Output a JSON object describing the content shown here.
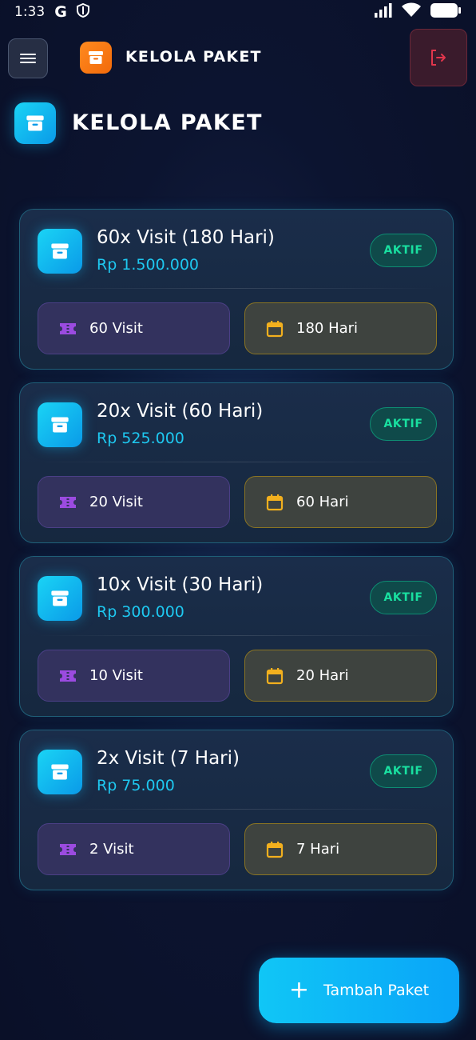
{
  "status_bar": {
    "time": "1:33"
  },
  "app_bar": {
    "title": "KELOLA PAKET"
  },
  "page": {
    "title": "KELOLA PAKET"
  },
  "packages": [
    {
      "name": "60x Visit (180 Hari)",
      "price": "Rp 1.500.000",
      "status": "AKTIF",
      "visits": "60 Visit",
      "days": "180 Hari"
    },
    {
      "name": "20x Visit (60 Hari)",
      "price": "Rp 525.000",
      "status": "AKTIF",
      "visits": "20 Visit",
      "days": "60 Hari"
    },
    {
      "name": "10x Visit (30 Hari)",
      "price": "Rp 300.000",
      "status": "AKTIF",
      "visits": "10 Visit",
      "days": "20 Hari"
    },
    {
      "name": "2x Visit (7 Hari)",
      "price": "Rp 75.000",
      "status": "AKTIF",
      "visits": "2 Visit",
      "days": "7 Hari"
    }
  ],
  "fab": {
    "label": "Tambah Paket"
  },
  "colors": {
    "accent": "#1ec8f0",
    "status_active": "#19e0a0",
    "logo_orange": "#ff8a1f",
    "visit_icon": "#9b4be0",
    "calendar_icon": "#f2b01e",
    "logout_red": "#e2364c"
  }
}
